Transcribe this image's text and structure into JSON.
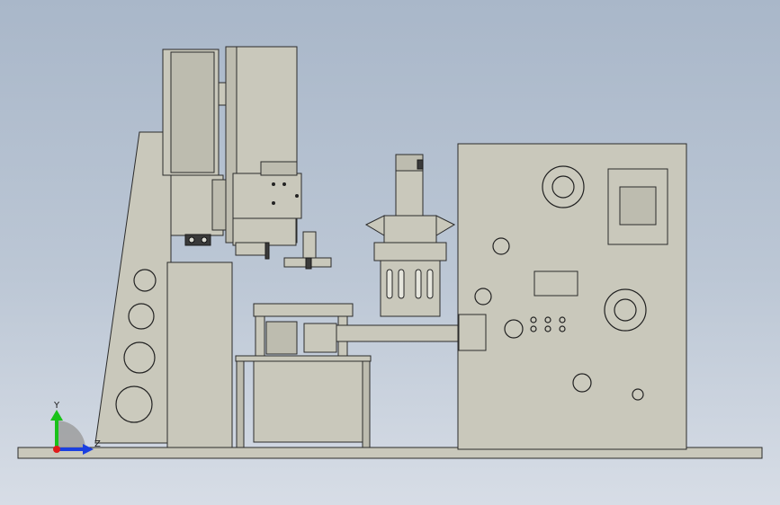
{
  "viewport": {
    "background_top": "#a9b7c9",
    "background_bottom": "#d7dde6",
    "part_color": "#c9c8bb",
    "edge_color": "#2b2b2b"
  },
  "triad": {
    "y_label": "Y",
    "z_label": "Z",
    "y_axis_color": "#19c219",
    "z_axis_color": "#1a3fe0",
    "origin_color": "#e01a1a"
  }
}
